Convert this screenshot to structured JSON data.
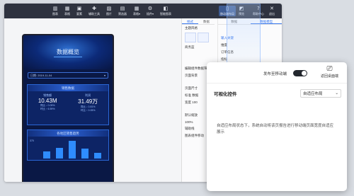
{
  "toolbar": {
    "items": [
      {
        "label": "图表",
        "icon": "chart-icon"
      },
      {
        "label": "表格",
        "icon": "table-icon"
      },
      {
        "label": "要素",
        "icon": "element-icon"
      },
      {
        "label": "辅助工具",
        "icon": "tools-icon"
      },
      {
        "label": "图片",
        "icon": "image-icon"
      },
      {
        "label": "筛选器",
        "icon": "filter-icon"
      },
      {
        "label": "表格▾",
        "icon": "table-dropdown-icon"
      },
      {
        "label": "插件▾",
        "icon": "plugin-icon"
      },
      {
        "label": "智能图表",
        "icon": "smart-chart-icon"
      }
    ],
    "right_items": [
      {
        "label": "移动端布局",
        "icon": "mobile-icon"
      },
      {
        "label": "预览",
        "icon": "preview-icon"
      },
      {
        "label": "帮助中心",
        "icon": "help-icon"
      },
      {
        "label": "退出",
        "icon": "exit-icon"
      }
    ]
  },
  "phone": {
    "title": "数据概览",
    "date": "日期: 2019-11-04",
    "card1": {
      "title": "销售数据",
      "stats": [
        {
          "label": "销售额",
          "value": "10.43M",
          "sub1": "同比 ↓ 0.09%",
          "sub2": "环比 ↑ 6.59%"
        },
        {
          "label": "利润",
          "value": "31.49万",
          "sub1": "同比 ↓ 0.81%",
          "sub2": "环比 ↑ 0.05%"
        }
      ]
    },
    "card2": {
      "title": "各地区销售趋势",
      "axis_label": "370",
      "bars": [
        0.35,
        0.55,
        0.9,
        0.5,
        0.3
      ]
    }
  },
  "panel": {
    "left_tabs": [
      "样式",
      "数据"
    ],
    "right_tabs": [
      "数据",
      "数据模型"
    ],
    "theme_label": "主题风格",
    "theme_items": [
      "商务蓝",
      "深海蓝"
    ],
    "labels": [
      "编辑组件数据筛选",
      "页面背景",
      "页面尺寸",
      "标准 数据",
      "宽度 100",
      "默认缩放",
      "100%",
      "辅助线",
      "图表组件移动",
      "订单信息",
      "维度",
      "指标"
    ],
    "search_placeholder": "输入关键"
  },
  "overlay": {
    "publish_label": "发布至移动端",
    "publish_on": true,
    "return_label": "返回桌面端",
    "section_title": "可视化控件",
    "select_value": "自适应布局",
    "description": "自适应布局状态下，系统自动将该页报告进行移动端页面宽度自适应展示"
  }
}
